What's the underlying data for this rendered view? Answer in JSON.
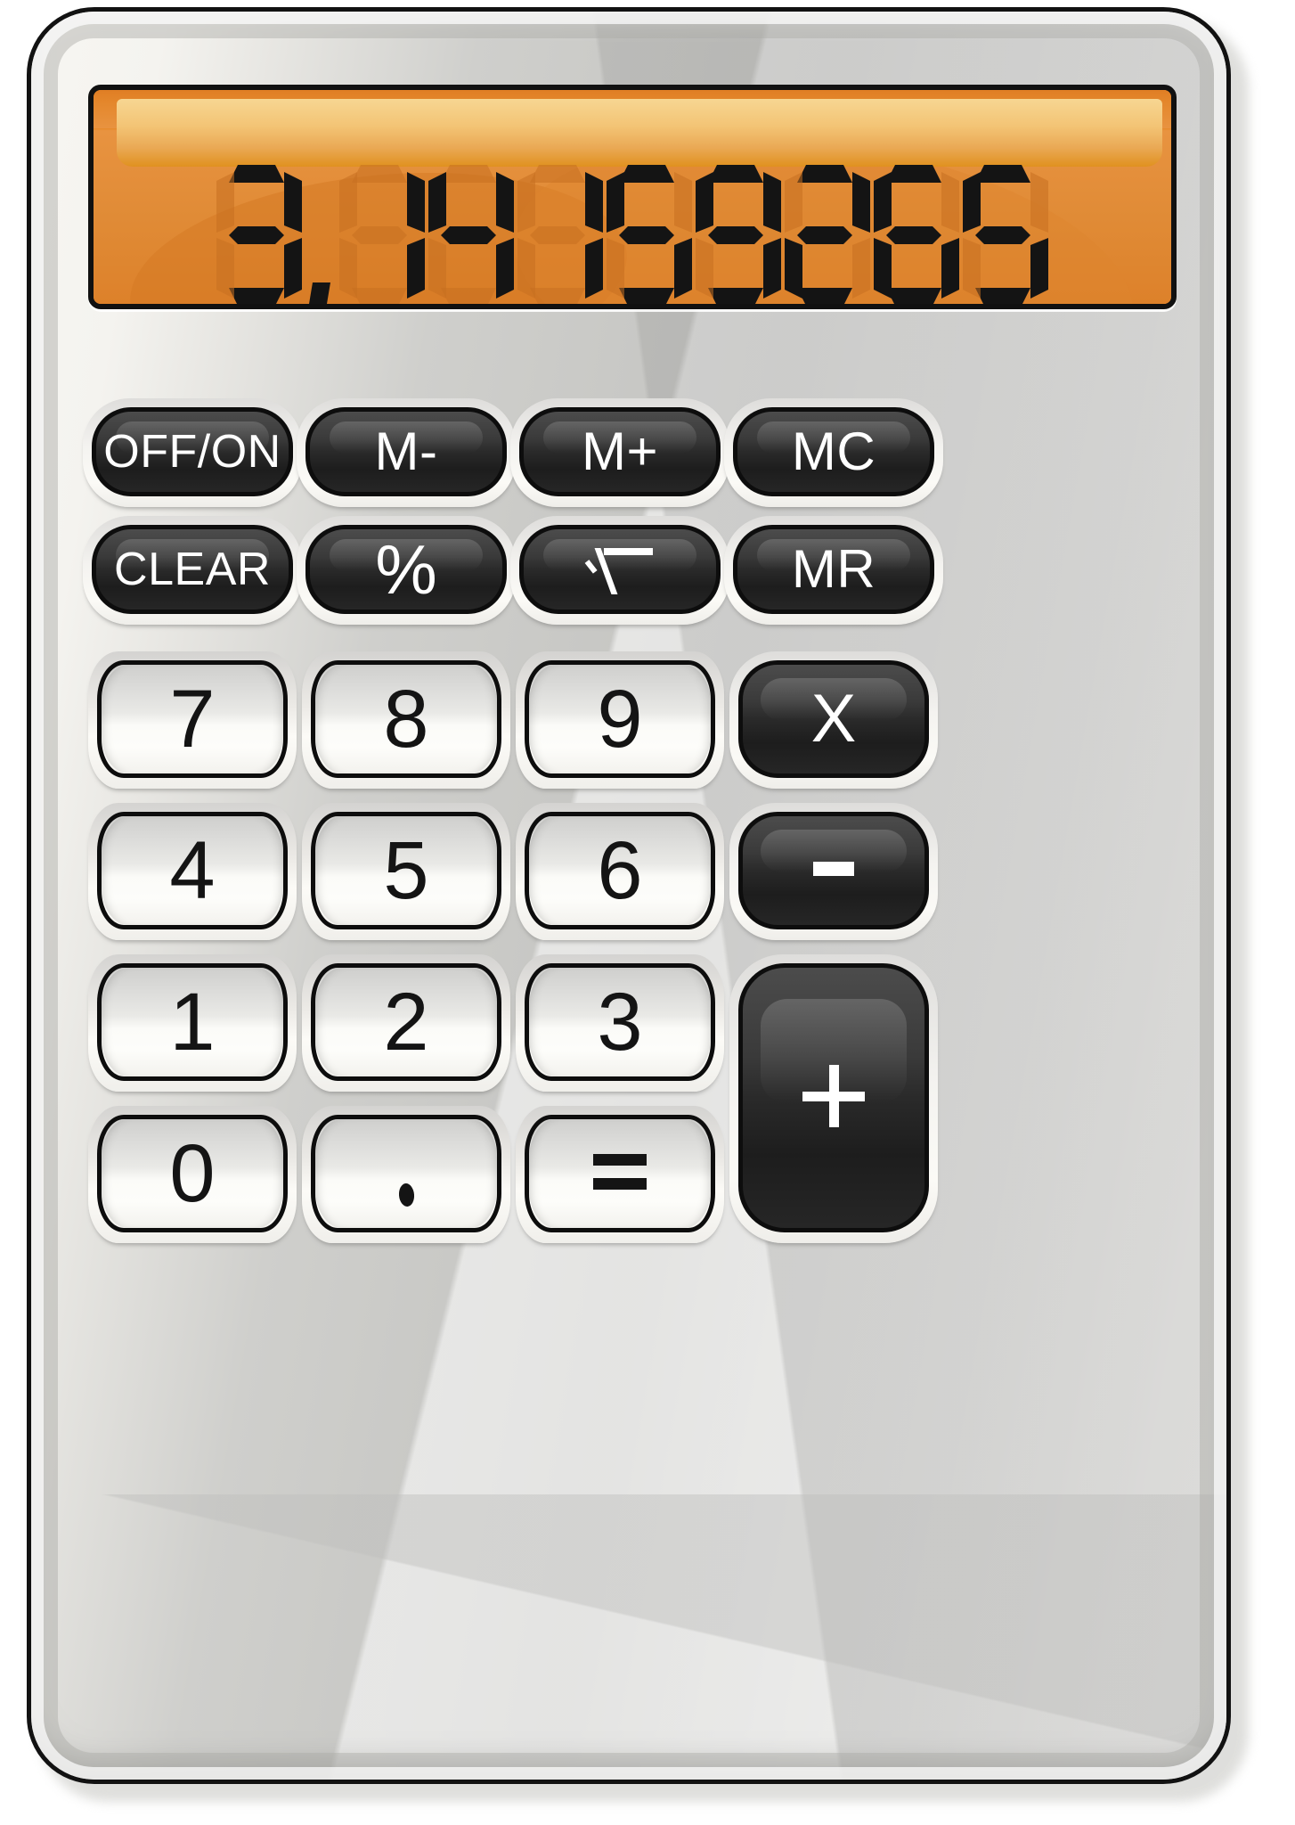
{
  "device": {
    "name": "pocket-calculator",
    "body_color": "#d2d2cf",
    "outline_color": "#121212"
  },
  "display": {
    "value": "3.14159265",
    "digits": [
      "3",
      ".",
      "1",
      "4",
      "1",
      "5",
      "9",
      "2",
      "6",
      "5"
    ],
    "screen_color": "#e5872c",
    "segment_color": "#141414",
    "gloss_color": "#f7d692"
  },
  "keypad": {
    "function_rows": [
      [
        {
          "id": "off-on",
          "label": "OFF/ON",
          "style": "dark",
          "glyph": "text"
        },
        {
          "id": "m-minus",
          "label": "M-",
          "style": "dark",
          "glyph": "text"
        },
        {
          "id": "m-plus",
          "label": "M+",
          "style": "dark",
          "glyph": "text"
        },
        {
          "id": "mc",
          "label": "MC",
          "style": "dark",
          "glyph": "text"
        }
      ],
      [
        {
          "id": "clear",
          "label": "CLEAR",
          "style": "dark",
          "glyph": "text"
        },
        {
          "id": "percent",
          "label": "%",
          "style": "dark",
          "glyph": "text"
        },
        {
          "id": "sqrt",
          "label": "√",
          "style": "dark",
          "glyph": "radical"
        },
        {
          "id": "mr",
          "label": "MR",
          "style": "dark",
          "glyph": "text"
        }
      ]
    ],
    "number_rows": [
      [
        {
          "id": "seven",
          "label": "7",
          "style": "light",
          "glyph": "num"
        },
        {
          "id": "eight",
          "label": "8",
          "style": "light",
          "glyph": "num"
        },
        {
          "id": "nine",
          "label": "9",
          "style": "light",
          "glyph": "num"
        },
        {
          "id": "multiply",
          "label": "X",
          "style": "dark",
          "glyph": "text"
        }
      ],
      [
        {
          "id": "four",
          "label": "4",
          "style": "light",
          "glyph": "num"
        },
        {
          "id": "five",
          "label": "5",
          "style": "light",
          "glyph": "num"
        },
        {
          "id": "six",
          "label": "6",
          "style": "light",
          "glyph": "num"
        },
        {
          "id": "subtract",
          "label": "−",
          "style": "dark",
          "glyph": "minus"
        }
      ],
      [
        {
          "id": "one",
          "label": "1",
          "style": "light",
          "glyph": "num"
        },
        {
          "id": "two",
          "label": "2",
          "style": "light",
          "glyph": "num"
        },
        {
          "id": "three",
          "label": "3",
          "style": "light",
          "glyph": "num"
        }
      ],
      [
        {
          "id": "zero",
          "label": "0",
          "style": "light",
          "glyph": "num"
        },
        {
          "id": "decimal",
          "label": ".",
          "style": "light",
          "glyph": "dot"
        },
        {
          "id": "equals",
          "label": "=",
          "style": "light",
          "glyph": "equals"
        }
      ]
    ],
    "add_key": {
      "id": "add",
      "label": "+",
      "style": "dark",
      "glyph": "plus"
    }
  }
}
